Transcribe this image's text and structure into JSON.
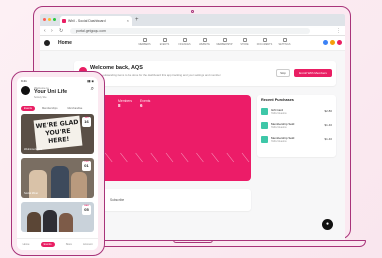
{
  "colors": {
    "accent": "#e91e63",
    "chart_bg": "#ec1c68",
    "bg": "#fdf0f4",
    "device_outline": "#a8347a"
  },
  "browser": {
    "tab_title": "Whil - Social Dashboard",
    "url": "portal.getgoqu.com"
  },
  "app_header": {
    "title": "Home",
    "nav": [
      {
        "label": "MEMBERS",
        "icon": "members-icon"
      },
      {
        "label": "EVENTS",
        "icon": "events-icon"
      },
      {
        "label": "FINANCES",
        "icon": "finances-icon"
      },
      {
        "label": "WEBSITE",
        "icon": "website-icon"
      },
      {
        "label": "MEMBERSHIP",
        "icon": "membership-icon"
      },
      {
        "label": "STORE",
        "icon": "store-icon"
      },
      {
        "label": "DOCUMENTS",
        "icon": "documents-icon"
      },
      {
        "label": "SETTINGS",
        "icon": "settings-icon"
      }
    ]
  },
  "welcome": {
    "title": "Welcome back, AQS",
    "subtitle": "You have outstanding items to be done for the dashboard this app tracking and your settings and member",
    "skip_label": "Skip",
    "enroll_label": "Enroll With Members"
  },
  "stats": {
    "members_label": "Members",
    "members_value": "8",
    "events_label": "Events",
    "events_value": "6"
  },
  "chart_data": {
    "type": "line",
    "categories": [
      "",
      "",
      "",
      "",
      "",
      "",
      "",
      "",
      "",
      "",
      ""
    ],
    "values": [
      0,
      0,
      0,
      0,
      0,
      0,
      0,
      0,
      0,
      0,
      0
    ],
    "title": "",
    "xlabel": "",
    "ylabel": ""
  },
  "bottom_card": {
    "label": "Subscribe"
  },
  "purchases": {
    "title": "Recent Purchases",
    "items": [
      {
        "name": "Gift Card",
        "meta": "Hollis Meadow",
        "price": "$2.80"
      },
      {
        "name": "Membership Sold",
        "meta": "Hollis Meadow",
        "price": "$1.40"
      },
      {
        "name": "Membership Sold",
        "meta": "Hollis Meadow",
        "price": "$1.40"
      }
    ]
  },
  "fab": {
    "icon": "chat-icon"
  },
  "phone": {
    "status_time": "9:41",
    "status_right": "▮▮ ◉",
    "welcome": "Welcome to",
    "title": "Your Uni Life",
    "subtitle": "Society Site",
    "tabs": [
      "Events",
      "Memberships",
      "Merchandise"
    ],
    "sign_text": "WE'RE GLAD YOU'RE HERE!",
    "cards": [
      {
        "month": "JAN",
        "day": "16",
        "caption": "Welcome Event"
      },
      {
        "month": "FEB",
        "day": "01",
        "caption": "Social Mixer"
      },
      {
        "month": "MAR",
        "day": "05",
        "caption": ""
      }
    ],
    "nav": [
      "Home",
      "Events",
      "Store",
      "Account"
    ]
  }
}
